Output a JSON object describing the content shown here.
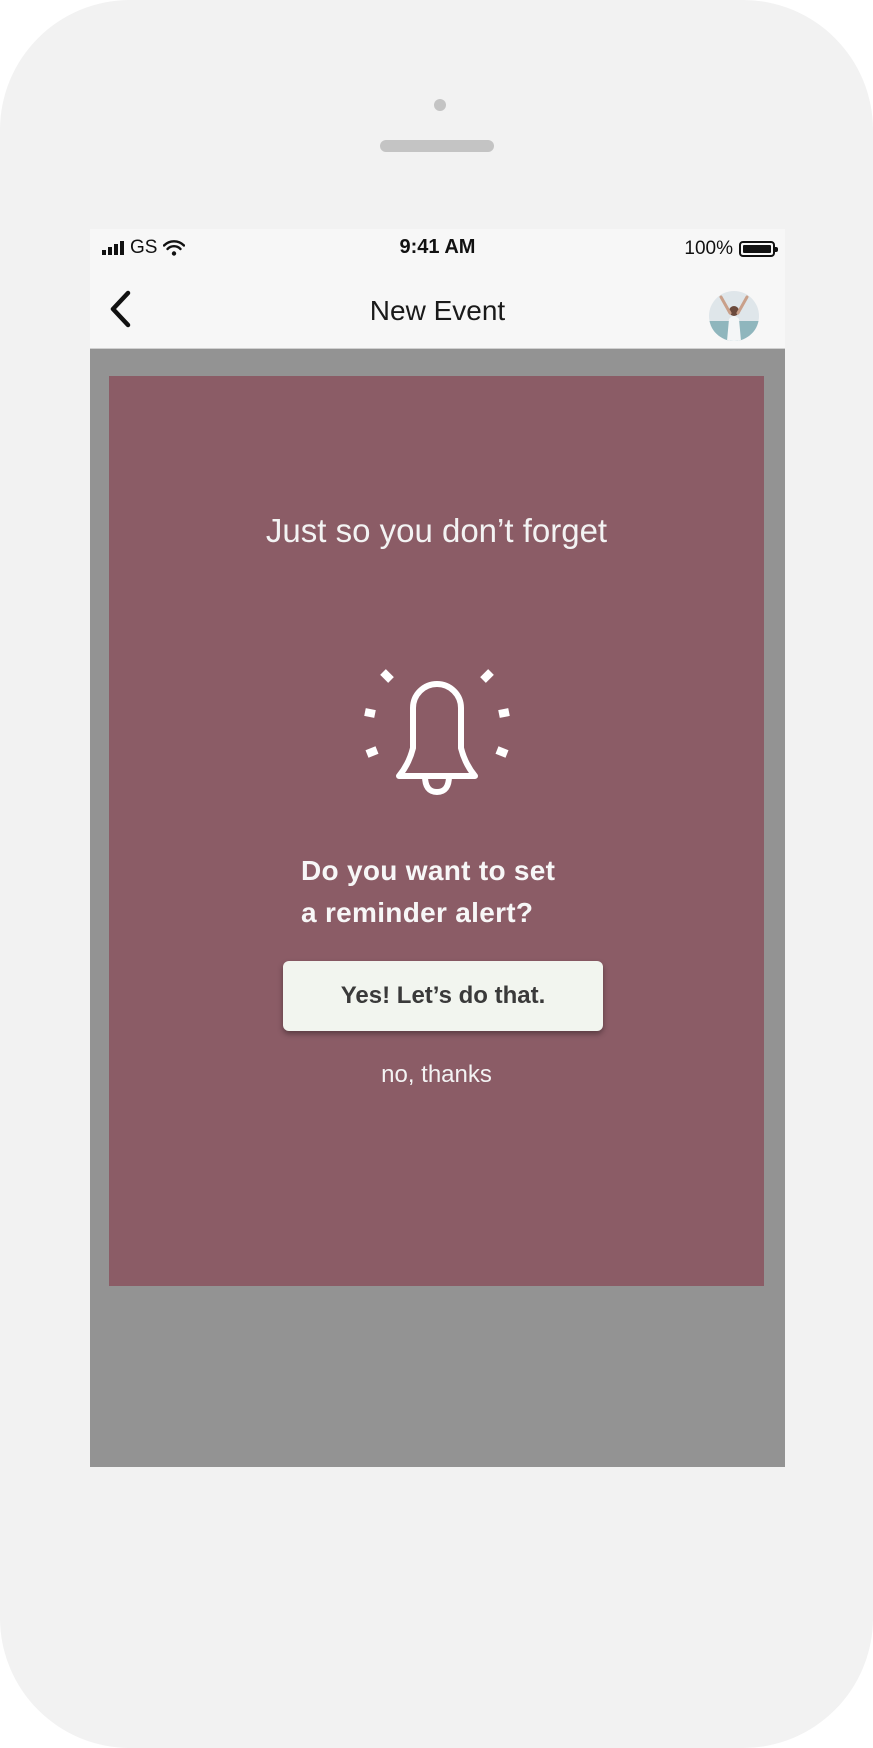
{
  "status_bar": {
    "carrier": "GS",
    "time": "9:41 AM",
    "battery_percent": "100%",
    "signal_icon": "signal-icon",
    "wifi_icon": "wifi-icon",
    "battery_icon": "battery-icon"
  },
  "nav": {
    "title": "New Event",
    "back_icon": "chevron-left-icon",
    "avatar": "avatar"
  },
  "modal": {
    "heading": "Just so you don’t forget",
    "icon": "bell-icon",
    "question_line1": "Do you want to set",
    "question_line2": "a reminder alert?",
    "confirm_label": "Yes! Let’s do that.",
    "decline_label": "no, thanks"
  },
  "colors": {
    "modal_bg": "#8b5c66",
    "overlay_bg": "#939393",
    "button_bg": "#f2f5ef"
  }
}
